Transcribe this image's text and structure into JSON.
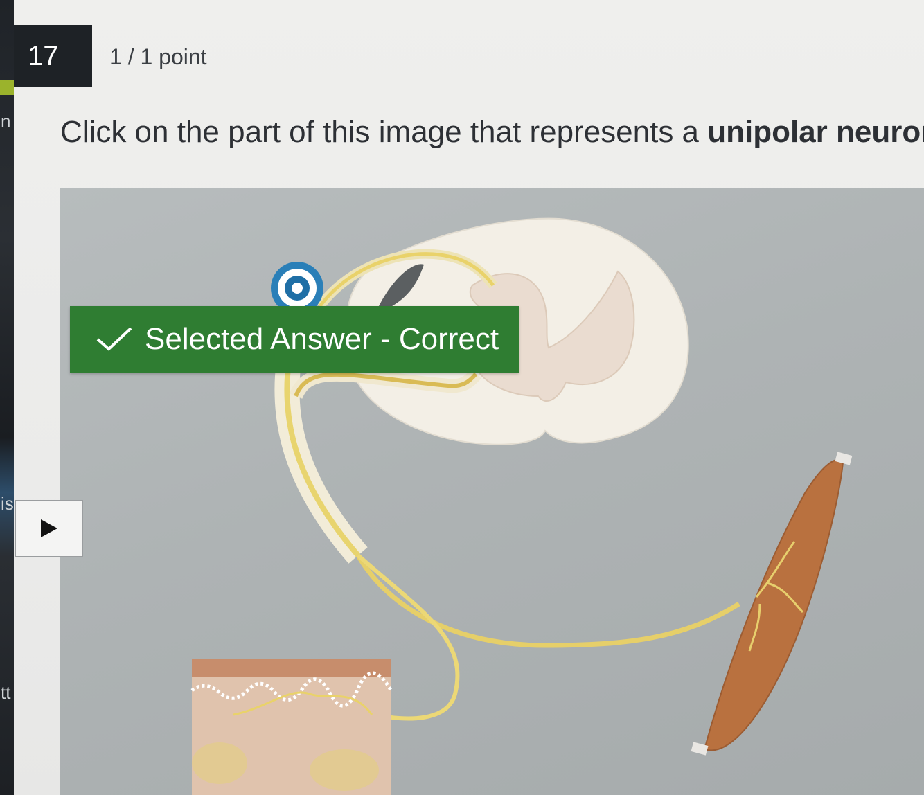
{
  "left_rail": {
    "fragments": [
      "n",
      "is",
      "tt"
    ]
  },
  "question": {
    "number": "17",
    "points": "1 / 1 point",
    "prompt_prefix": "Click on the part of this image that represents a ",
    "prompt_bold": "unipolar neuron."
  },
  "hotspot": {
    "feedback_label": "Selected Answer - Correct",
    "status_color": "#2f7d32",
    "target_icon": "hotspot-target-icon",
    "check_icon": "check-icon"
  },
  "navigation": {
    "next_icon": "play-triangle-icon"
  }
}
